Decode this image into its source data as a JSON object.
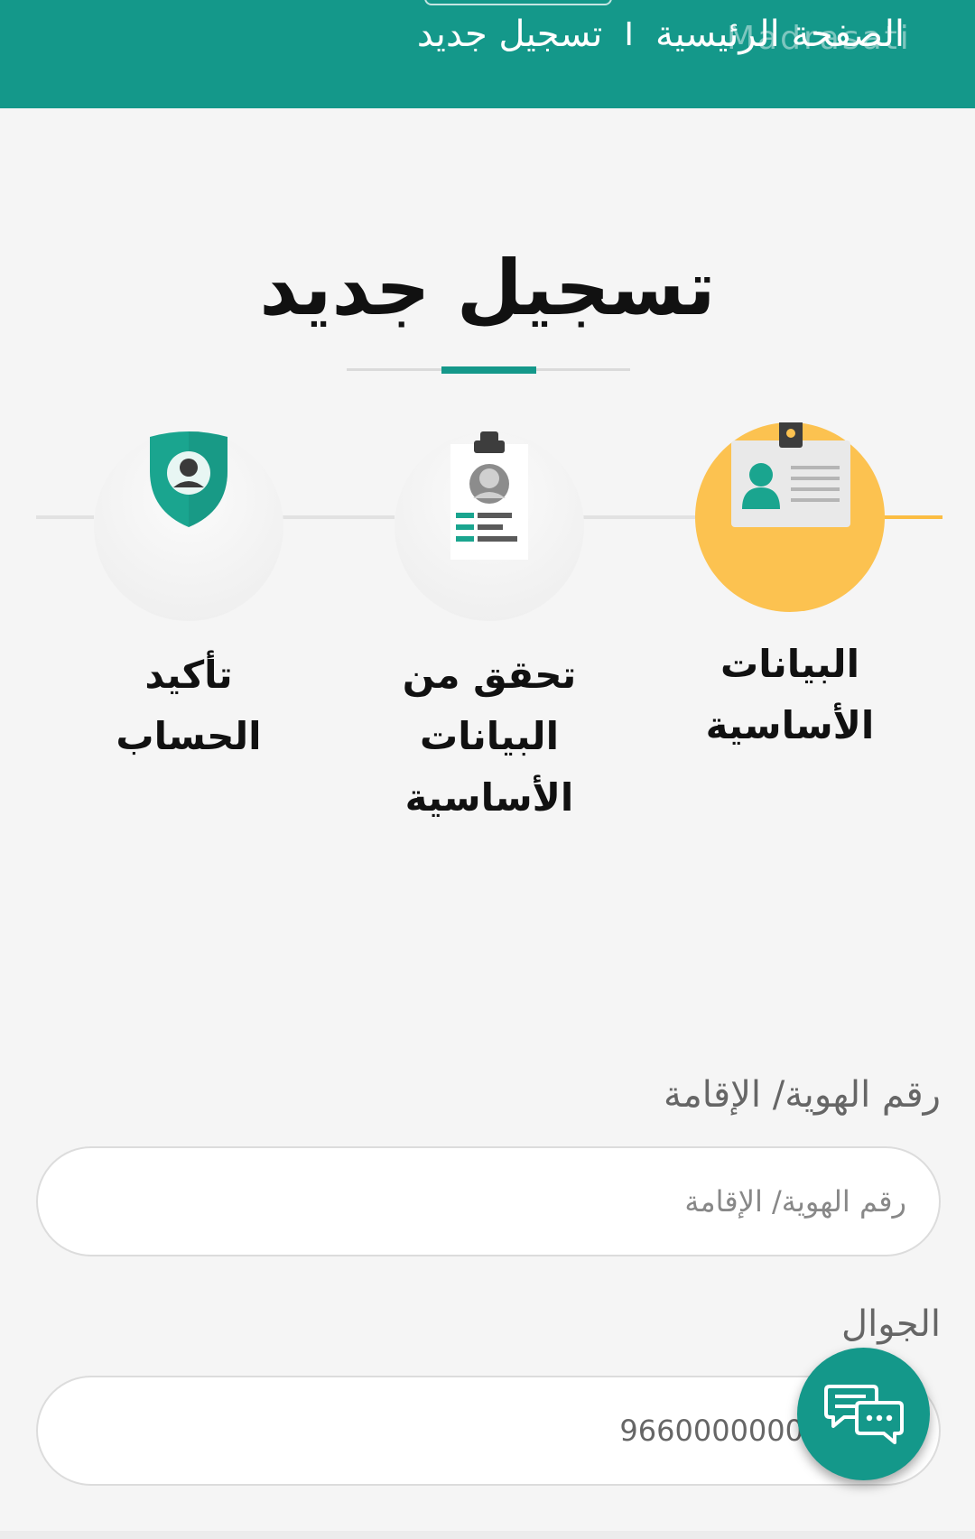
{
  "header": {
    "breadcrumb_home": "الصفحة الرئيسية",
    "breadcrumb_separator": "I",
    "breadcrumb_current": "تسجيل جديد",
    "watermark": "Madrasati"
  },
  "page_title": "تسجيل جديد",
  "steps": [
    {
      "label": "البيانات الأساسية",
      "icon": "id-card-icon",
      "active": true
    },
    {
      "label": "تحقق من البيانات الأساسية",
      "icon": "profile-document-icon",
      "active": false
    },
    {
      "label": "تأكيد الحساب",
      "icon": "user-shield-icon",
      "active": false
    }
  ],
  "form": {
    "id_label": "رقم الهوية/ الإقامة",
    "id_placeholder": "رقم الهوية/ الإقامة",
    "mobile_label": "الجوال",
    "mobile_placeholder": "9660000000"
  },
  "colors": {
    "primary": "#14988a",
    "step_active": "#fcc250",
    "step_line_active": "#fbbd42",
    "background": "#f5f5f5"
  },
  "chat_button": {
    "icon": "chat-bubbles-icon"
  }
}
